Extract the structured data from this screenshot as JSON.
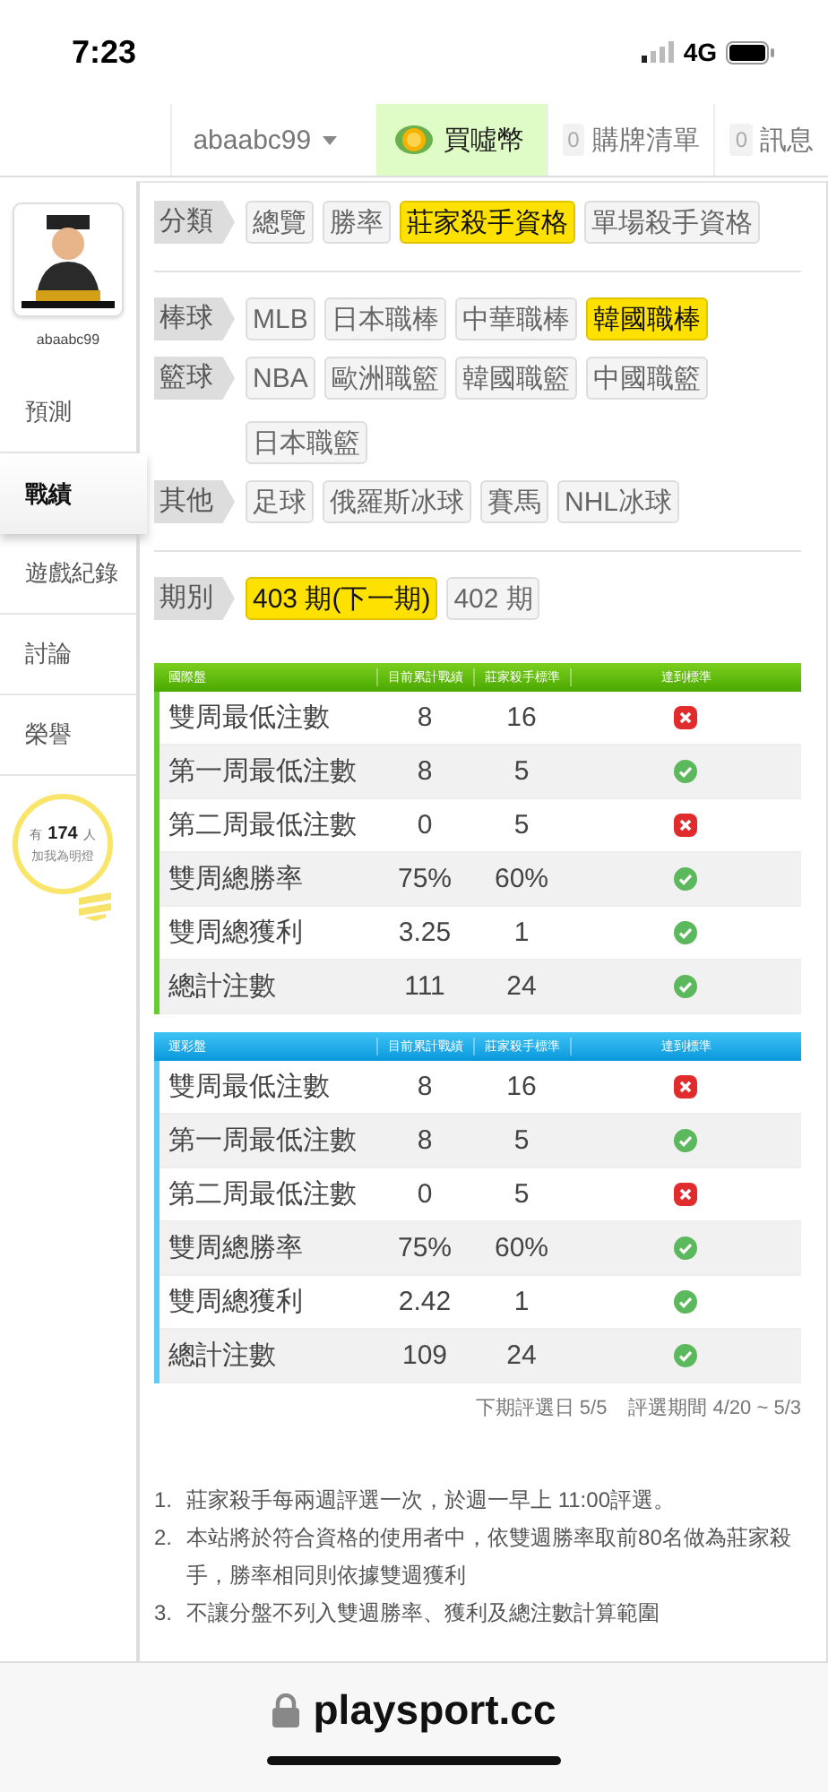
{
  "status_bar": {
    "time": "7:23",
    "network": "4G"
  },
  "nav": {
    "user": "abaabc99",
    "buy": "買噓幣",
    "cart_count": "0",
    "cart": "購牌清單",
    "msg_count": "0",
    "msg": "訊息"
  },
  "sidebar": {
    "username": "abaabc99",
    "items": [
      {
        "label": "預測",
        "selected": false
      },
      {
        "label": "戰績",
        "selected": true
      },
      {
        "label": "遊戲紀錄",
        "selected": false
      },
      {
        "label": "討論",
        "selected": false
      },
      {
        "label": "榮譽",
        "selected": false
      }
    ],
    "fans": {
      "prefix": "有",
      "count": "174",
      "suffix": "人",
      "caption": "加我為明燈"
    }
  },
  "filters": [
    {
      "label": "分類",
      "divider": true,
      "tags": [
        {
          "text": "總覽",
          "selected": false
        },
        {
          "text": "勝率",
          "selected": false
        },
        {
          "text": "莊家殺手資格",
          "selected": true
        },
        {
          "text": "單場殺手資格",
          "selected": false
        }
      ]
    },
    {
      "label": "棒球",
      "divider": false,
      "tags": [
        {
          "text": "MLB",
          "selected": false
        },
        {
          "text": "日本職棒",
          "selected": false
        },
        {
          "text": "中華職棒",
          "selected": false
        },
        {
          "text": "韓國職棒",
          "selected": true
        }
      ]
    },
    {
      "label": "籃球",
      "divider": false,
      "tags": [
        {
          "text": "NBA",
          "selected": false
        },
        {
          "text": "歐洲職籃",
          "selected": false
        },
        {
          "text": "韓國職籃",
          "selected": false
        },
        {
          "text": "中國職籃",
          "selected": false
        },
        {
          "text": "日本職籃",
          "selected": false
        }
      ]
    },
    {
      "label": "其他",
      "divider": true,
      "tags": [
        {
          "text": "足球",
          "selected": false
        },
        {
          "text": "俄羅斯冰球",
          "selected": false
        },
        {
          "text": "賽馬",
          "selected": false
        },
        {
          "text": "NHL冰球",
          "selected": false
        }
      ]
    },
    {
      "label": "期別",
      "divider": false,
      "tags": [
        {
          "text": "403 期(下一期)",
          "selected": true
        },
        {
          "text": "402 期",
          "selected": false
        }
      ]
    }
  ],
  "tables": [
    {
      "kind": "green",
      "columns": [
        "國際盤",
        "目前累計戰績",
        "莊家殺手標準",
        "達到標準"
      ],
      "rows": [
        {
          "item": "雙周最低注數",
          "current": "8",
          "standard": "16",
          "passed": false
        },
        {
          "item": "第一周最低注數",
          "current": "8",
          "standard": "5",
          "passed": true
        },
        {
          "item": "第二周最低注數",
          "current": "0",
          "standard": "5",
          "passed": false
        },
        {
          "item": "雙周總勝率",
          "current": "75%",
          "standard": "60%",
          "passed": true
        },
        {
          "item": "雙周總獲利",
          "current": "3.25",
          "standard": "1",
          "passed": true
        },
        {
          "item": "總計注數",
          "current": "111",
          "standard": "24",
          "passed": true
        }
      ]
    },
    {
      "kind": "blue",
      "columns": [
        "運彩盤",
        "目前累計戰績",
        "莊家殺手標準",
        "達到標準"
      ],
      "rows": [
        {
          "item": "雙周最低注數",
          "current": "8",
          "standard": "16",
          "passed": false
        },
        {
          "item": "第一周最低注數",
          "current": "8",
          "standard": "5",
          "passed": true
        },
        {
          "item": "第二周最低注數",
          "current": "0",
          "standard": "5",
          "passed": false
        },
        {
          "item": "雙周總勝率",
          "current": "75%",
          "standard": "60%",
          "passed": true
        },
        {
          "item": "雙周總獲利",
          "current": "2.42",
          "standard": "1",
          "passed": true
        },
        {
          "item": "總計注數",
          "current": "109",
          "standard": "24",
          "passed": true
        }
      ]
    }
  ],
  "period_note": {
    "next_date": "下期評選日 5/5",
    "period": "評選期間 4/20 ~ 5/3"
  },
  "rules": [
    {
      "num": "1.",
      "text": "莊家殺手每兩週評選一次，於週一早上 11:00評選。"
    },
    {
      "num": "2.",
      "text": "本站將於符合資格的使用者中，依雙週勝率取前80名做為莊家殺手，勝率相同則依據雙週獲利"
    },
    {
      "num": "3.",
      "text": "不讓分盤不列入雙週勝率、獲利及總注數計算範圍"
    }
  ],
  "address_bar": {
    "domain": "playsport.cc"
  }
}
